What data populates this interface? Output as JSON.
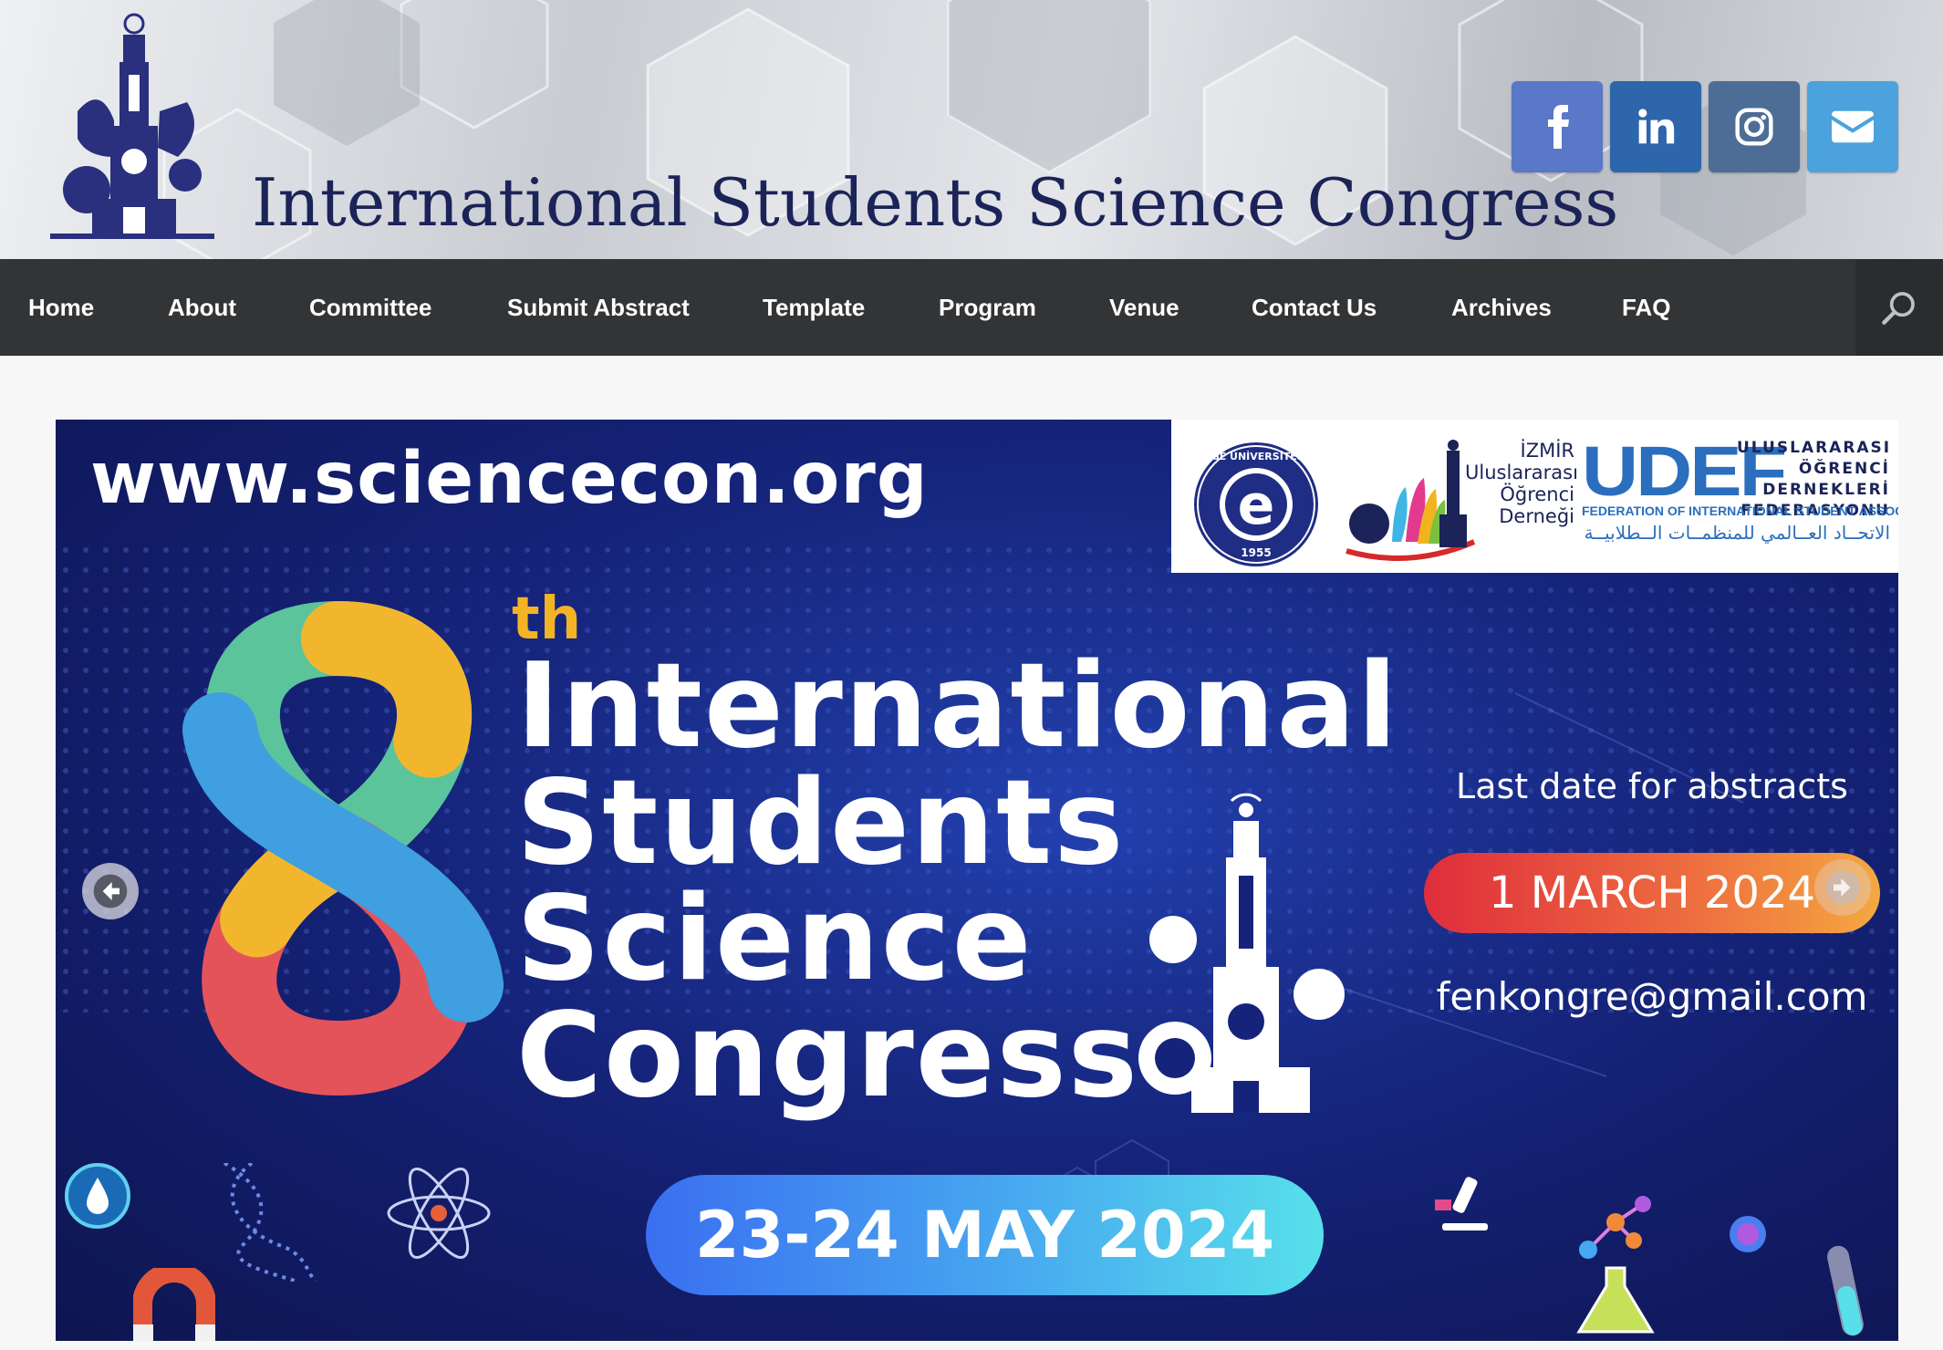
{
  "header": {
    "site_title": "International Students Science Congress",
    "logo_icon": "izmir-clock-tower-logo",
    "social": [
      {
        "name": "facebook",
        "icon": "facebook-icon",
        "color": "#5a78c7"
      },
      {
        "name": "linkedin",
        "icon": "linkedin-icon",
        "color": "#2d66ab"
      },
      {
        "name": "instagram",
        "icon": "instagram-icon",
        "color": "#4d6d96"
      },
      {
        "name": "email",
        "icon": "envelope-icon",
        "color": "#4ba2dc"
      }
    ]
  },
  "nav": {
    "items": [
      "Home",
      "About",
      "Committee",
      "Submit Abstract",
      "Template",
      "Program",
      "Venue",
      "Contact Us",
      "Archives",
      "FAQ"
    ],
    "search_icon": "search-icon",
    "background": "#333436"
  },
  "slider": {
    "url": "www.sciencecon.org",
    "edition_number": "8",
    "edition_suffix": "th",
    "title_lines": [
      "International",
      "Students",
      "Science",
      "Congress"
    ],
    "deadline_label": "Last date for abstracts",
    "deadline_date": "1 MARCH 2024",
    "email": "fenkongre@gmail.com",
    "event_dates": "23-24 MAY 2024",
    "partners": {
      "ege": {
        "ring_text": "EGE ÜNİVERSİTESİ",
        "letter": "e",
        "year": "1955"
      },
      "izmir": {
        "lines": [
          "İZMİR",
          "Uluslararası",
          "Öğrenci",
          "Derneği"
        ]
      },
      "udef": {
        "acronym": "UDEF",
        "right_lines": [
          "ULUSLARARASI",
          "ÖĞRENCİ DERNEKLERİ",
          "FEDERASYONU"
        ],
        "english": "FEDERATION OF INTERNATIONAL STUDENT ASSOCIATIONS",
        "arabic": "الاتحــاد العــالمي للمنظمــات الــطلابيــة"
      }
    },
    "prev_icon": "arrow-left-icon",
    "next_icon": "arrow-right-icon",
    "colors": {
      "deadline_pill": "#e94a3c",
      "date_pill": "#48a9f0",
      "accent_gold": "#f3b324"
    }
  }
}
